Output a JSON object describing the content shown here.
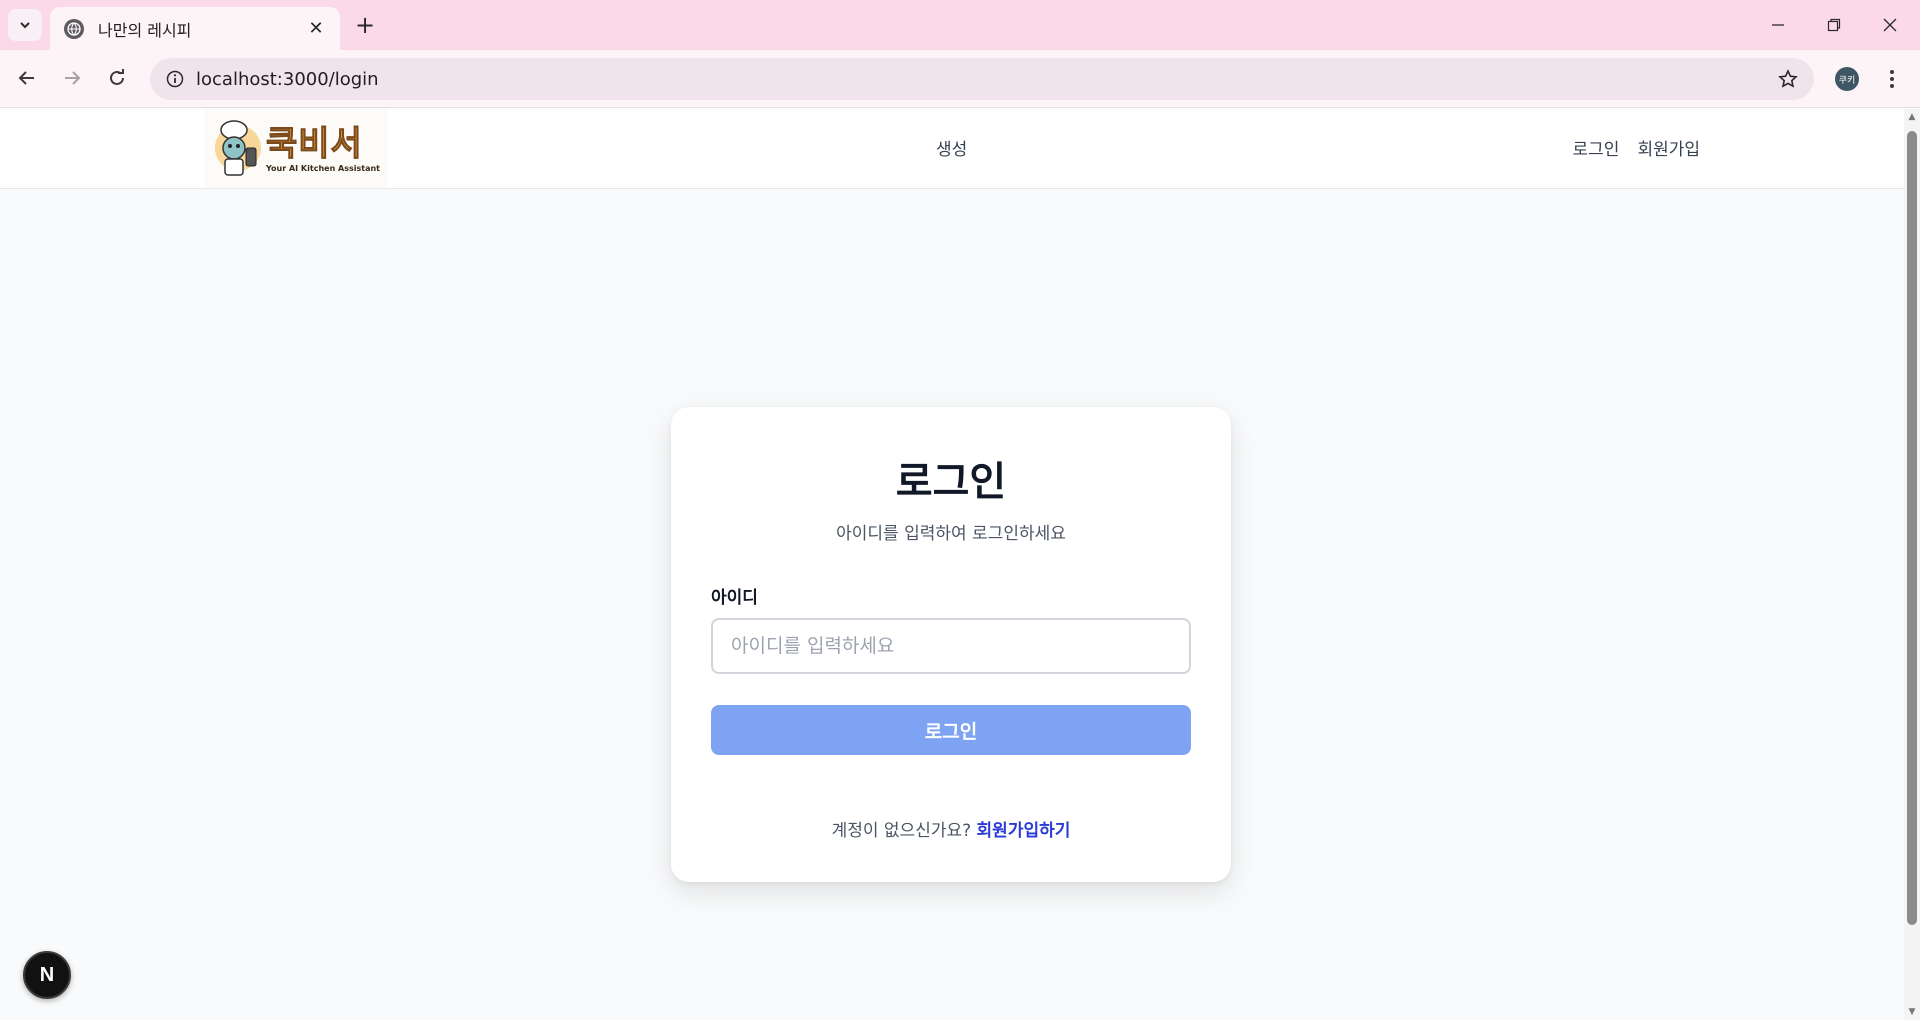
{
  "browser": {
    "tab_title": "나만의 레시피",
    "tab_close": "✕",
    "new_tab": "+",
    "url": "localhost:3000/login",
    "profile_label": "쿠키"
  },
  "header": {
    "logo_title": "쿡비서",
    "logo_subtitle": "Your AI Kitchen Assistant",
    "nav_center": "생성",
    "nav_login": "로그인",
    "nav_signup": "회원가입"
  },
  "login": {
    "title": "로그인",
    "subtitle": "아이디를 입력하여 로그인하세요",
    "id_label": "아이디",
    "id_placeholder": "아이디를 입력하세요",
    "id_value": "",
    "submit_label": "로그인",
    "signup_prompt": "계정이 없으신가요?",
    "signup_link": "회원가입하기"
  },
  "dev_badge": "N",
  "colors": {
    "tabbar_bg": "#fbd9e8",
    "button_bg": "#7ea3f2",
    "link": "#2a3bd8",
    "page_bg": "#f9fafb"
  }
}
